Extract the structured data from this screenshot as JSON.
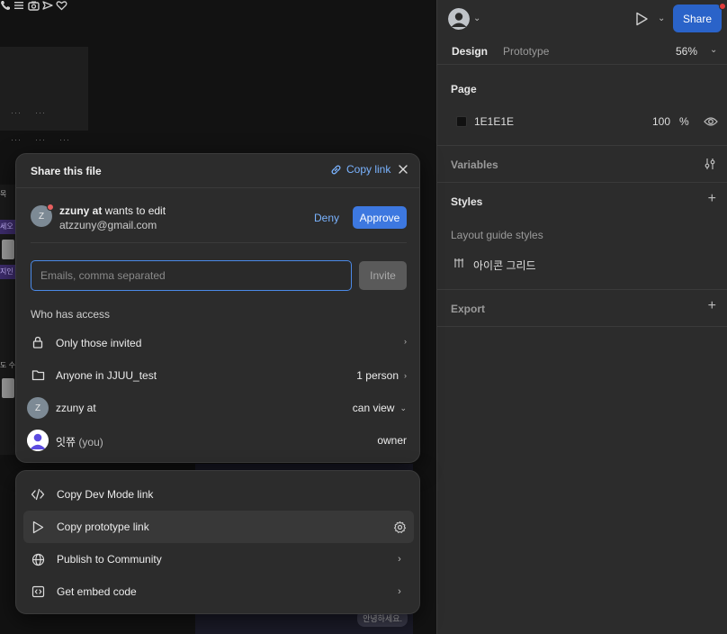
{
  "canvas": {
    "left_chip_1": "세오",
    "left_chip_2": "지인",
    "left_chip_3": "도 수",
    "left_label_top": "목",
    "bubble": "안녕하세요."
  },
  "panel": {
    "tabs": [
      "Design",
      "Prototype"
    ],
    "zoom": "56%",
    "share_label": "Share",
    "page": {
      "title": "Page",
      "color_hex": "1E1E1E",
      "opacity": "100",
      "opacity_unit": "%"
    },
    "variables_title": "Variables",
    "styles_title": "Styles",
    "layout_guide_title": "Layout guide styles",
    "layout_guide_item": "아이콘 그리드",
    "export_title": "Export"
  },
  "share_modal": {
    "title": "Share this file",
    "copy_link": "Copy link",
    "request": {
      "avatar_letter": "Z",
      "name": "zzuny at",
      "action": " wants to edit",
      "email": "atzzuny@gmail.com",
      "deny": "Deny",
      "approve": "Approve"
    },
    "invite": {
      "placeholder": "Emails, comma separated",
      "button": "Invite"
    },
    "who_has_access": "Who has access",
    "access": [
      {
        "label": "Only those invited",
        "right": ""
      },
      {
        "label": "Anyone in JJUU_test",
        "right": "1 person"
      },
      {
        "label": "zzuny at",
        "right": "can view",
        "avatar_letter": "Z"
      },
      {
        "label": "잇쮸",
        "you": " (you)",
        "right": "owner"
      }
    ]
  },
  "link_menu": {
    "items": [
      "Copy Dev Mode link",
      "Copy prototype link",
      "Publish to Community",
      "Get embed code"
    ]
  },
  "colors": {
    "accent": "#3d78e0",
    "link": "#7ab3ff",
    "share": "#2a63c9"
  }
}
